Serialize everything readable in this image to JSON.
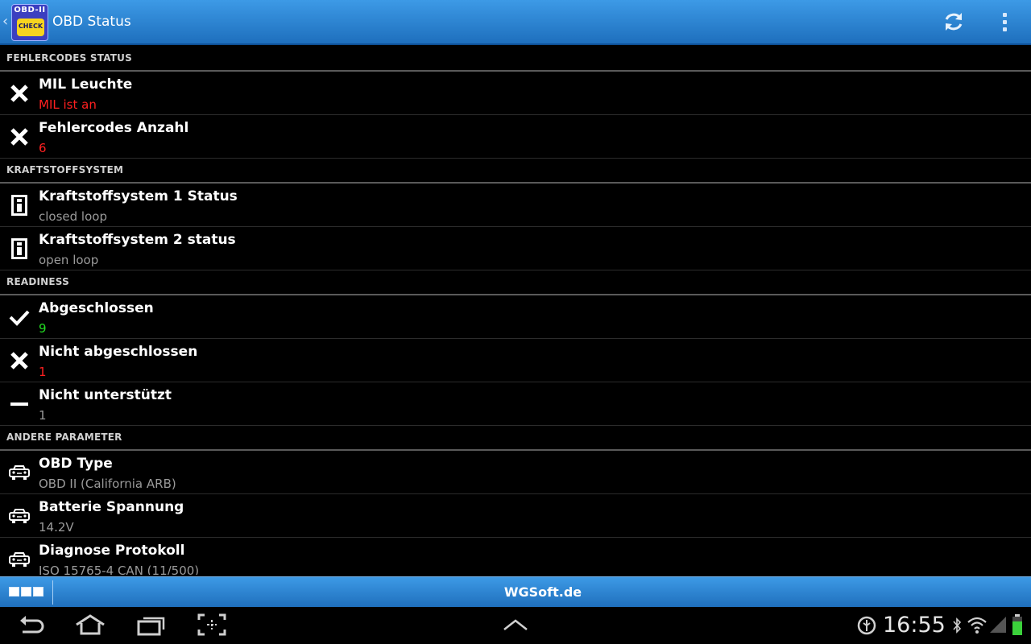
{
  "app": {
    "title": "OBD Status",
    "logo_text_top": "OBD-II",
    "logo_text_badge": "CHECK",
    "back_glyph": "‹"
  },
  "actions": {
    "refresh_icon": "refresh-icon",
    "overflow_icon": "overflow-menu-icon"
  },
  "colors": {
    "accent": "#2a86d8",
    "error": "#ff2020",
    "ok": "#22dd22",
    "neutral": "#9a9a9a"
  },
  "sections": [
    {
      "header": "FEHLERCODES STATUS",
      "items": [
        {
          "icon": "cross",
          "label": "MIL Leuchte",
          "value": "MIL ist an",
          "status": "error"
        },
        {
          "icon": "cross",
          "label": "Fehlercodes Anzahl",
          "value": "6",
          "status": "error"
        }
      ]
    },
    {
      "header": "KRAFTSTOFFSYSTEM",
      "items": [
        {
          "icon": "info",
          "label": "Kraftstoffsystem 1 Status",
          "value": "closed loop",
          "status": "neutral"
        },
        {
          "icon": "info",
          "label": "Kraftstoffsystem 2 status",
          "value": "open loop",
          "status": "neutral"
        }
      ]
    },
    {
      "header": "READINESS",
      "items": [
        {
          "icon": "check",
          "label": "Abgeschlossen",
          "value": "9",
          "status": "ok"
        },
        {
          "icon": "cross",
          "label": "Nicht abgeschlossen",
          "value": "1",
          "status": "error"
        },
        {
          "icon": "dash",
          "label": "Nicht unterstützt",
          "value": "1",
          "status": "neutral"
        }
      ]
    },
    {
      "header": "ANDERE PARAMETER",
      "items": [
        {
          "icon": "car",
          "label": "OBD Type",
          "value": "OBD II (California ARB)",
          "status": "neutral"
        },
        {
          "icon": "car",
          "label": "Batterie Spannung",
          "value": "14.2V",
          "status": "neutral"
        },
        {
          "icon": "car",
          "label": "Diagnose Protokoll",
          "value": "ISO 15765-4 CAN (11/500)",
          "status": "neutral"
        }
      ]
    }
  ],
  "bottom_bar": {
    "title": "WGSoft.de",
    "grid_icon": "view-grid-icon"
  },
  "system_bar": {
    "time": "16:55",
    "icons": [
      "back-icon",
      "home-icon",
      "recent-apps-icon",
      "screenshot-icon",
      "up-chevron-icon",
      "usb-debug-icon",
      "bluetooth-icon",
      "wifi-icon",
      "signal-icon",
      "battery-icon"
    ]
  }
}
